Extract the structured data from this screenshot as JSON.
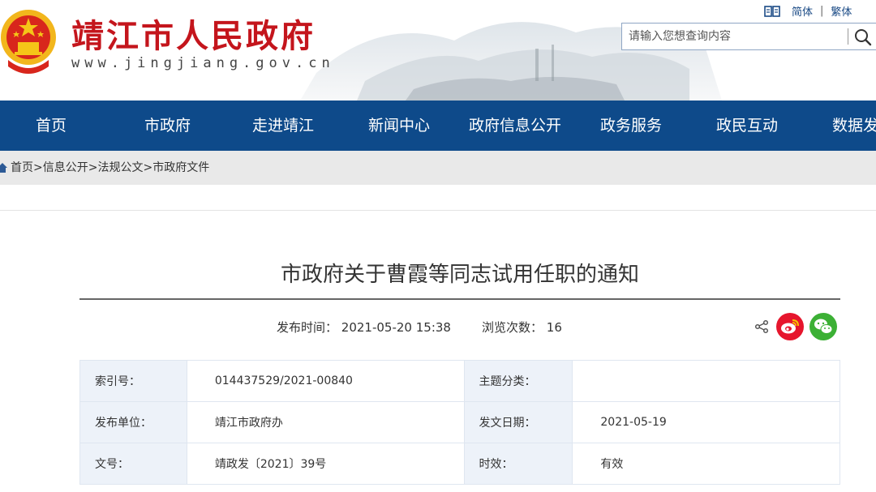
{
  "header": {
    "site_title": "靖江市人民政府",
    "site_url": "www.jingjiang.gov.cn",
    "lang_simplified": "简体",
    "lang_traditional": "繁体",
    "lang_separator": "|",
    "search_placeholder": "请输入您想查询内容",
    "brand_color": "#c4151c"
  },
  "nav": {
    "color": "#0e4a8a",
    "items": [
      "首页",
      "市政府",
      "走进靖江",
      "新闻中心",
      "政府信息公开",
      "政务服务",
      "政民互动",
      "数据发布"
    ]
  },
  "breadcrumb": "首页>信息公开>法规公文>市政府文件",
  "article": {
    "title": "市政府关于曹霞等同志试用任职的通知",
    "publish_label": "发布时间：",
    "publish_time": "2021-05-20 15:38",
    "views_label": "浏览次数：",
    "views": "16"
  },
  "info_table": [
    {
      "l1": "索引号：",
      "v1": "014437529/2021-00840",
      "l2": "主题分类：",
      "v2": ""
    },
    {
      "l1": "发布单位：",
      "v1": "靖江市政府办",
      "l2": "发文日期：",
      "v2": "2021-05-19"
    },
    {
      "l1": "文号：",
      "v1": "靖政发〔2021〕39号",
      "l2": "时效：",
      "v2": "有效"
    }
  ],
  "icons": [
    "emblem",
    "book-icon",
    "search-icon",
    "home-icon",
    "share-icon",
    "weibo-icon",
    "wechat-icon"
  ]
}
